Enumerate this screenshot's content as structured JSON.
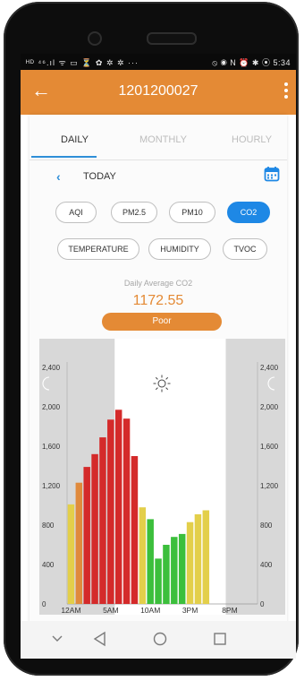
{
  "status_bar": {
    "left_icons": "ᴴᴰ ⁴⁶.ıl ᯤ ▭ ⏳ ✿ ✲ ✲ ···",
    "right_icons": "⦸ ◉ N ⏰ ✱ ⦿",
    "time": "5:34"
  },
  "app_bar": {
    "title": "1201200027",
    "back_icon": "back-arrow-icon",
    "menu_icon": "more-vertical-icon"
  },
  "tabs": [
    {
      "label": "DAILY",
      "active": true
    },
    {
      "label": "MONTHLY",
      "active": false
    },
    {
      "label": "HOURLY",
      "active": false
    }
  ],
  "day_nav": {
    "prev_icon": "chevron-left-icon",
    "label": "TODAY",
    "calendar_icon": "calendar-icon"
  },
  "metrics": {
    "row1": [
      {
        "label": "AQI",
        "active": false
      },
      {
        "label": "PM2.5",
        "active": false
      },
      {
        "label": "PM10",
        "active": false
      },
      {
        "label": "CO2",
        "active": true
      }
    ],
    "row2": [
      {
        "label": "TEMPERATURE",
        "active": false
      },
      {
        "label": "HUMIDITY",
        "active": false
      },
      {
        "label": "TVOC",
        "active": false
      }
    ]
  },
  "summary": {
    "label": "Daily Average CO2",
    "value": "1172.55",
    "status": "Poor",
    "status_color": "#e48a35"
  },
  "colors": {
    "accent": "#e48a35",
    "blue": "#1e88e5",
    "bar_red": "#d42a2a",
    "bar_orange": "#e08a3c",
    "bar_yellow": "#e3cf4a",
    "bar_green": "#3cbf3c"
  },
  "chart_data": {
    "type": "bar",
    "ylim": [
      0,
      2400
    ],
    "y_ticks": [
      "0",
      "400",
      "800",
      "1,200",
      "1,600",
      "2,000",
      "2,400"
    ],
    "x_ticks": [
      "12AM",
      "5AM",
      "10AM",
      "3PM",
      "8PM"
    ],
    "night_shading": "night hours shaded grey (12AM–6AM and after 8PM)",
    "icons": [
      "moon-icon",
      "sun-icon"
    ],
    "hours": [
      0,
      1,
      2,
      3,
      4,
      5,
      6,
      7,
      8,
      9,
      10,
      11,
      12,
      13,
      14,
      15,
      16,
      17,
      18,
      19
    ],
    "values": [
      1010,
      1230,
      1390,
      1520,
      1690,
      1870,
      1970,
      1880,
      1500,
      980,
      860,
      460,
      600,
      680,
      710,
      830,
      910,
      950,
      null,
      null
    ],
    "bar_colors": [
      "yellow",
      "orange",
      "red",
      "red",
      "red",
      "red",
      "red",
      "red",
      "red",
      "yellow",
      "green",
      "green",
      "green",
      "green",
      "green",
      "yellow",
      "yellow",
      "yellow",
      null,
      null
    ]
  }
}
